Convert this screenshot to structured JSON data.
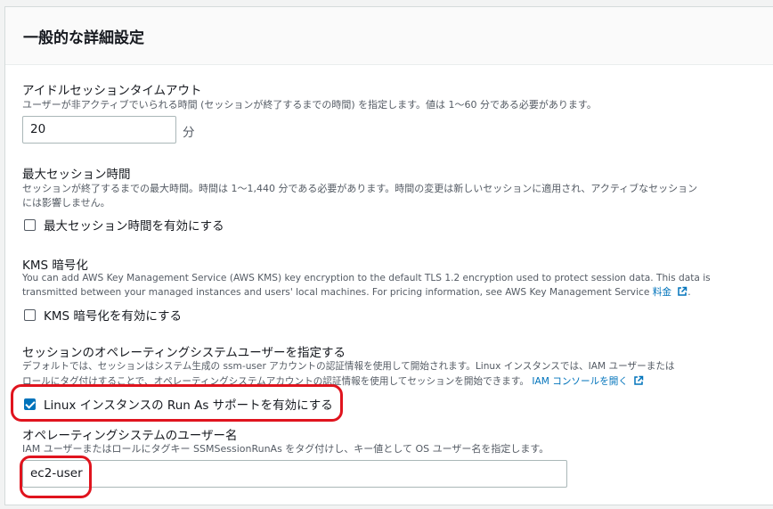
{
  "panel": {
    "title": "一般的な詳細設定"
  },
  "idle_timeout": {
    "label": "アイドルセッションタイムアウト",
    "description": "ユーザーが非アクティブでいられる時間 (セッションが終了するまでの時間) を指定します。値は 1〜60 分である必要があります。",
    "value": "20",
    "unit": "分"
  },
  "max_session": {
    "label": "最大セッション時間",
    "description_line1": "セッションが終了するまでの最大時間。時間は 1〜1,440 分である必要があります。時間の変更は新しいセッションに適用され、アクティブなセッション",
    "description_line2": "には影響しません。",
    "checkbox_label": "最大セッション時間を有効にする",
    "checked": false
  },
  "kms": {
    "label": "KMS 暗号化",
    "description_line1": "You can add AWS Key Management Service (AWS KMS) key encryption to the default TLS 1.2 encryption used to protect session data. This data is",
    "description_line2": "transmitted between your managed instances and users' local machines. For pricing information, see AWS Key Management Service",
    "pricing_link": "料金",
    "period": ".",
    "checkbox_label": "KMS 暗号化を有効にする",
    "checked": false
  },
  "run_as": {
    "label": "セッションのオペレーティングシステムユーザーを指定する",
    "description_line1": "デフォルトでは、セッションはシステム生成の ssm-user アカウントの認証情報を使用して開始されます。Linux インスタンスでは、IAM ユーザーまたは",
    "description_line2": "ロールにタグ付けすることで、オペレーティングシステムアカウントの認証情報を使用してセッションを開始できます。",
    "iam_link": "IAM コンソールを開く",
    "checkbox_label": "Linux インスタンスの Run As サポートを有効にする",
    "checked": true
  },
  "os_user": {
    "label": "オペレーティングシステムのユーザー名",
    "description": "IAM ユーザーまたはロールにタグキー SSMSessionRunAs をタグ付けし、キー値として OS ユーザー名を指定します。",
    "value": "ec2-user"
  },
  "icons": {
    "external_link": "external-link-icon",
    "checkbox_checked": "checkmark-icon"
  },
  "colors": {
    "link": "#0073bb",
    "checkbox_checked": "#0073bb",
    "highlight_annotation": "#e0141e"
  }
}
